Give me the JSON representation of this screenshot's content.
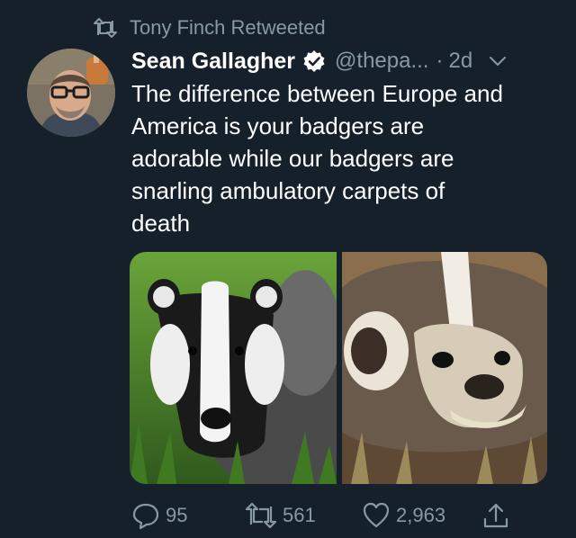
{
  "retweet_context": {
    "text": "Tony Finch Retweeted",
    "icon": "retweet-icon"
  },
  "author": {
    "display_name": "Sean Gallagher",
    "verified": true,
    "handle": "@thepa...",
    "separator": "·",
    "time": "2d"
  },
  "tweet": {
    "lines": [
      "The difference between Europe and",
      "America is your badgers are",
      "adorable while our badgers are",
      "snarling ambulatory carpets of",
      "death"
    ]
  },
  "media": {
    "photos": [
      {
        "name": "european-badger-photo"
      },
      {
        "name": "american-badger-photo"
      }
    ]
  },
  "actions": {
    "reply_count": "95",
    "retweet_count": "561",
    "like_count": "2,963"
  },
  "colors": {
    "background": "#15202b",
    "text": "#ffffff",
    "secondary": "#8899a6"
  }
}
